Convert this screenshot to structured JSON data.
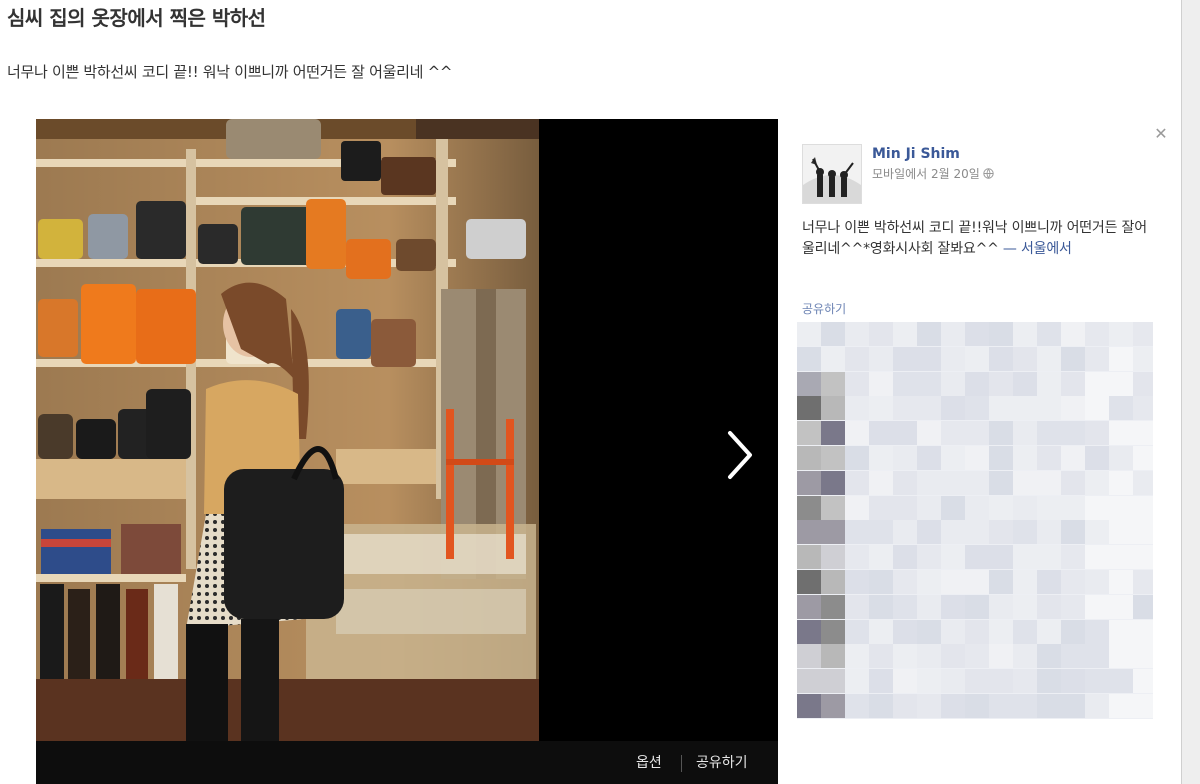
{
  "page": {
    "title": "심씨 집의 옷장에서 찍은 박하선",
    "subtitle": "너무나 이쁜 박하선씨 코디 끝!! 워낙 이쁘니까 어떤거든 잘 어울리네 ^^"
  },
  "viewer": {
    "next_icon": "chevron-right-icon",
    "options_label": "옵션",
    "share_label": "공유하기"
  },
  "post": {
    "close_icon": "close-icon",
    "author": "Min Ji Shim",
    "meta": "모바일에서 2월 20일",
    "privacy_icon": "globe-icon",
    "text": "너무나 이쁜 박하선씨 코디 끝!!워낙 이쁘니까 어떤거든 잘어울리네^^*영화시사회 잘봐요^^",
    "place_link": "— 서울에서",
    "share_link": "공유하기"
  },
  "colors": {
    "link": "#3b5998",
    "viewer_bg": "#000000",
    "comments_bg": "#edeff4"
  }
}
